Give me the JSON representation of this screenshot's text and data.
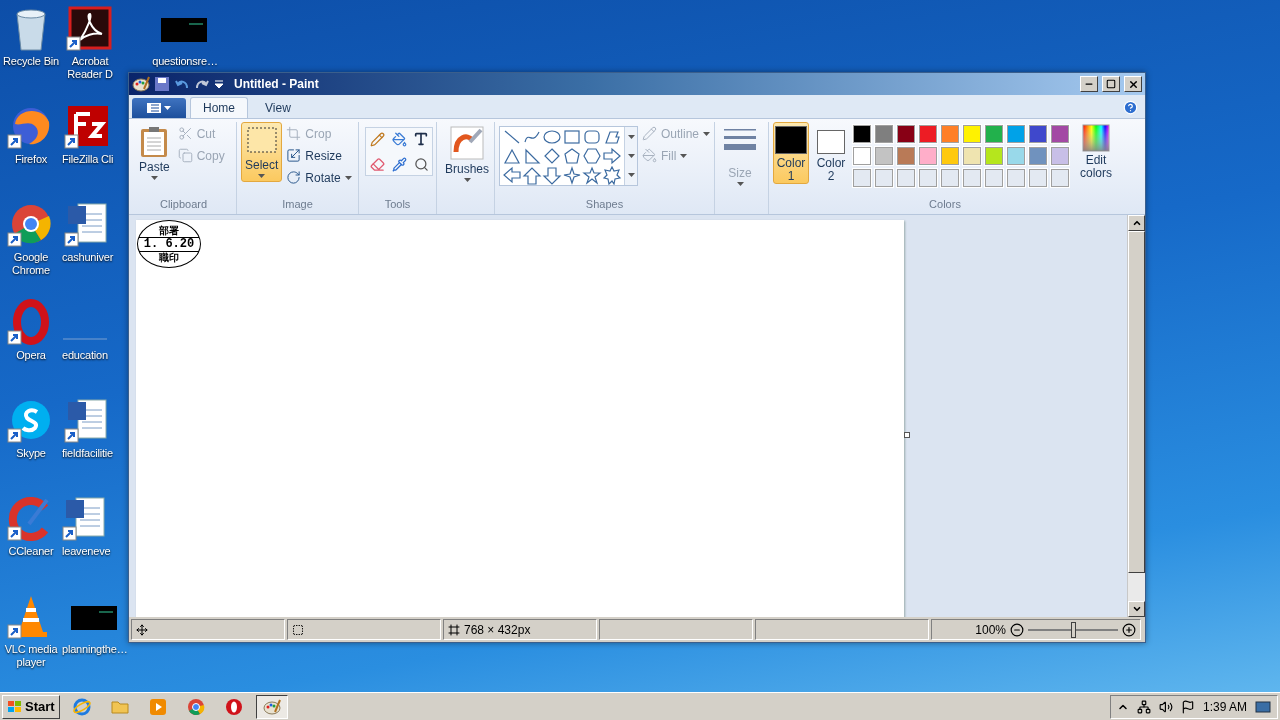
{
  "desktop": {
    "icons": [
      {
        "label": "Recycle Bin",
        "kind": "recycle",
        "shortcut": false
      },
      {
        "label": "Firefox",
        "kind": "firefox",
        "shortcut": true
      },
      {
        "label": "Google Chrome",
        "kind": "chrome",
        "shortcut": true
      },
      {
        "label": "Opera",
        "kind": "opera",
        "shortcut": true
      },
      {
        "label": "Skype",
        "kind": "skype",
        "shortcut": true
      },
      {
        "label": "CCleaner",
        "kind": "ccleaner",
        "shortcut": true
      },
      {
        "label": "VLC media player",
        "kind": "vlc",
        "shortcut": true
      },
      {
        "label": "Acrobat Reader D",
        "kind": "acrobat",
        "shortcut": true
      },
      {
        "label": "FileZilla Cli",
        "kind": "filezilla",
        "shortcut": true
      },
      {
        "label": "cashuniver",
        "kind": "word",
        "shortcut": true
      },
      {
        "label": "education",
        "kind": "blank"
      },
      {
        "label": "fieldfacilitie",
        "kind": "word",
        "shortcut": true
      },
      {
        "label": "leaveneve",
        "kind": "word",
        "shortcut": true
      },
      {
        "label": "planningthe…",
        "kind": "black",
        "shortcut": false
      },
      {
        "label": "questionsre…",
        "kind": "black",
        "shortcut": false
      }
    ]
  },
  "window": {
    "title": "Untitled - Paint",
    "tabs": [
      {
        "label": "Home",
        "selected": true
      },
      {
        "label": "View",
        "selected": false
      }
    ],
    "ribbon": {
      "clipboard": {
        "label": "Clipboard",
        "paste": "Paste",
        "cut": {
          "label": "Cut",
          "disabled": true
        },
        "copy": {
          "label": "Copy",
          "disabled": true
        }
      },
      "image": {
        "label": "Image",
        "select": {
          "label": "Select",
          "selected": true
        },
        "crop": {
          "label": "Crop",
          "disabled": true
        },
        "resize": {
          "label": "Resize",
          "disabled": false
        },
        "rotate": {
          "label": "Rotate",
          "disabled": false
        }
      },
      "tools": {
        "label": "Tools"
      },
      "brushes": {
        "label": "Brushes"
      },
      "shapes": {
        "label": "Shapes",
        "outline": {
          "label": "Outline",
          "disabled": true
        },
        "fill": {
          "label": "Fill",
          "disabled": true
        }
      },
      "size": {
        "label": "Size",
        "disabled": true
      },
      "colors": {
        "label": "Colors",
        "color1": {
          "label": "Color 1",
          "selected": true,
          "color": "#000000"
        },
        "color2": {
          "label": "Color 2",
          "selected": false,
          "color": "#ffffff"
        },
        "palette": [
          {
            "color": "#000000"
          },
          {
            "color": "#7f7f7f"
          },
          {
            "color": "#880015"
          },
          {
            "color": "#ed1c24"
          },
          {
            "color": "#ff7f27"
          },
          {
            "color": "#fff200"
          },
          {
            "color": "#22b14c"
          },
          {
            "color": "#00a2e8"
          },
          {
            "color": "#3f48cc"
          },
          {
            "color": "#a349a4"
          },
          {
            "color": "#ffffff"
          },
          {
            "color": "#c3c3c3"
          },
          {
            "color": "#b97a57"
          },
          {
            "color": "#ffaec9"
          },
          {
            "color": "#ffc90e"
          },
          {
            "color": "#efe4b0"
          },
          {
            "color": "#b5e61d"
          },
          {
            "color": "#99d9ea"
          },
          {
            "color": "#7092be"
          },
          {
            "color": "#c8bfe7"
          }
        ],
        "edit": "Edit colors"
      }
    },
    "canvas": {
      "stamp": {
        "top": "部署",
        "date": "1. 6.20",
        "bottom": "職印"
      }
    },
    "status_bar": {
      "dimensions": "768 × 432px",
      "zoom": {
        "text": "100%",
        "level": 0.5
      }
    }
  },
  "taskbar": {
    "start": "Start",
    "apps": [
      {
        "kind": "ie",
        "selected": false
      },
      {
        "kind": "explorer",
        "selected": false
      },
      {
        "kind": "media",
        "selected": false
      },
      {
        "kind": "chrome",
        "selected": false
      },
      {
        "kind": "opera",
        "selected": false
      },
      {
        "kind": "paint",
        "selected": true
      }
    ],
    "clock": "1:39 AM"
  }
}
